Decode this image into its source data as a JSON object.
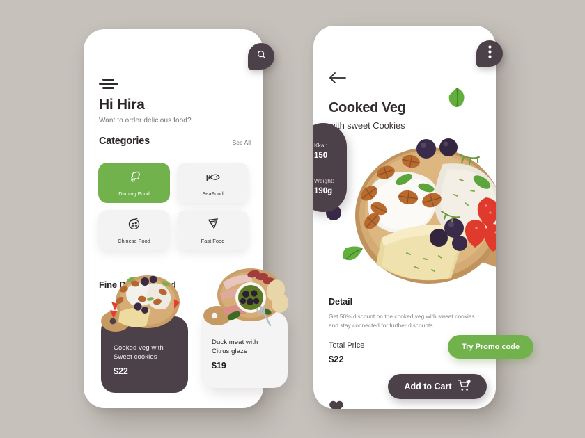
{
  "theme": {
    "background": "#c6c1bb",
    "accent_green": "#72b24d",
    "dark": "#4c4148",
    "card_light": "#f3f3f3"
  },
  "home": {
    "menu_icon": "hamburger-icon",
    "search_icon": "search-icon",
    "greeting": "Hi Hira",
    "subgreeting": "Want to order delicious food?",
    "categories_title": "Categories",
    "see_all": "See All",
    "categories": [
      {
        "label": "Dinning Food",
        "icon": "drumstick-icon",
        "active": true
      },
      {
        "label": "SeaFood",
        "icon": "fish-icon",
        "active": false
      },
      {
        "label": "Chinese Food",
        "icon": "noodle-bowl-icon",
        "active": false
      },
      {
        "label": "Fast Food",
        "icon": "pizza-slice-icon",
        "active": false
      }
    ],
    "list_title": "Fine Dinning Food",
    "items": [
      {
        "name": "Cooked veg with\nSweet cookies",
        "name_line1": "Cooked veg with",
        "name_line2": "Sweet cookies",
        "price": "$22"
      },
      {
        "name": "Duck meat with\nCitrus glaze",
        "name_line1": "Duck meat with",
        "name_line2": "Citrus glaze",
        "price": "$19"
      }
    ]
  },
  "detail": {
    "back_icon": "back-arrow-icon",
    "more_icon": "more-vertical-icon",
    "title": "Cooked Veg",
    "subtitle": "with sweet Cookies",
    "nutrition": {
      "kcal_label": "Kkal:",
      "kcal_value": "150",
      "weight_label": "Weight:",
      "weight_value": "190g"
    },
    "detail_heading": "Detail",
    "detail_text": "Get 50% discount on the cooked veg with sweet cookies and stay connected for further discounts",
    "detail_line1": "Get 50% discount on the cooked veg with sweet",
    "detail_line2": "cookies and stay connected for further discounts",
    "total_price_label": "Total Price",
    "total_price_value": "$22",
    "promo_button": "Try Promo code",
    "favorite_icon": "heart-icon",
    "cart_button": "Add to Cart",
    "cart_icon": "cart-plus-icon"
  }
}
